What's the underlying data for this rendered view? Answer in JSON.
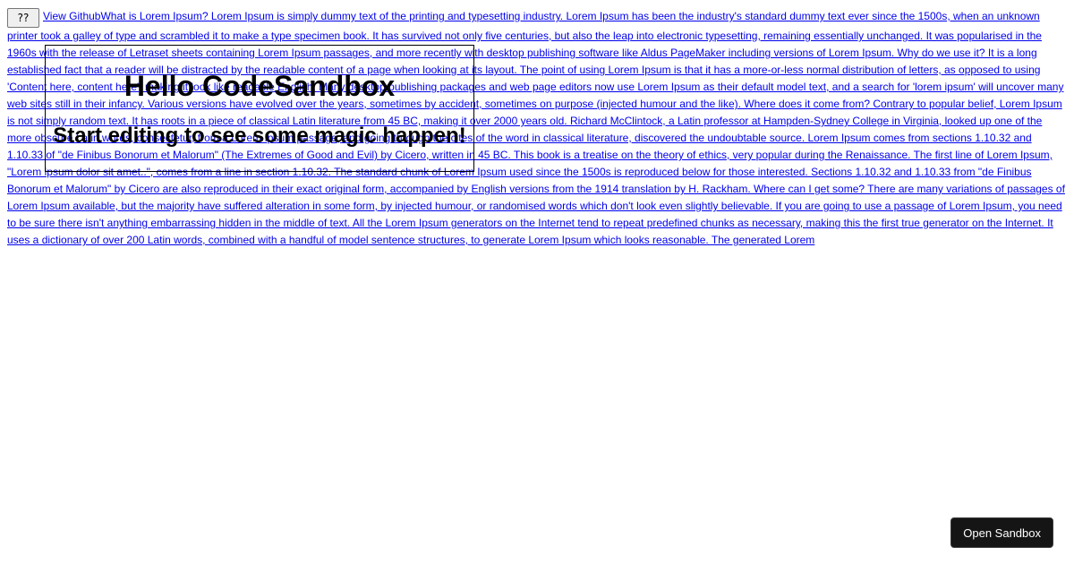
{
  "toolbar": {
    "menu_button_label": "??",
    "github_link": "View Github"
  },
  "body_text": "What is Lorem Ipsum? Lorem Ipsum is simply dummy text of the printing and typesetting industry. Lorem Ipsum has been the industry's standard dummy text ever since the 1500s, when an unknown printer took a galley of type and scrambled it to make a type specimen book. It has survived not only five centuries, but also the leap into electronic typesetting, remaining essentially unchanged. It was popularised in the 1960s with the release of Letraset sheets containing Lorem Ipsum passages, and more recently with desktop publishing software like Aldus PageMaker including versions of Lorem Ipsum. Why do we use it? It is a long established fact that a reader will be distracted by the readable content of a page when looking at its layout. The point of using Lorem Ipsum is that it has a more-or-less normal distribution of letters, as opposed to using 'Content here, content here', making it look like readable English. Many desktop publishing packages and web page editors now use Lorem Ipsum as their default model text, and a search for 'lorem ipsum' will uncover many web sites still in their infancy. Various versions have evolved over the years, sometimes by accident, sometimes on purpose (injected humour and the like). Where does it come from? Contrary to popular belief, Lorem Ipsum is not simply random text. It has roots in a piece of classical Latin literature from 45 BC, making it over 2000 years old. Richard McClintock, a Latin professor at Hampden-Sydney College in Virginia, looked up one of the more obscure Latin words, consectetur, from a Lorem Ipsum passage, and going through the cites of the word in classical literature, discovered the undoubtable source. Lorem Ipsum comes from sections 1.10.32 and 1.10.33 of \"de Finibus Bonorum et Malorum\" (The Extremes of Good and Evil) by Cicero, written in 45 BC. This book is a treatise on the theory of ethics, very popular during the Renaissance. The first line of Lorem Ipsum, \"Lorem ipsum dolor sit amet..\", comes from a line in section 1.10.32. The standard chunk of Lorem Ipsum used since the 1500s is reproduced below for those interested. Sections 1.10.32 and 1.10.33 from \"de Finibus Bonorum et Malorum\" by Cicero are also reproduced in their exact original form, accompanied by English versions from the 1914 translation by H. Rackham. Where can I get some? There are many variations of passages of Lorem Ipsum available, but the majority have suffered alteration in some form, by injected humour, or randomised words which don't look even slightly believable. If you are going to use a passage of Lorem Ipsum, you need to be sure there isn't anything embarrassing hidden in the middle of text. All the Lorem Ipsum generators on the Internet tend to repeat predefined chunks as necessary, making this the first true generator on the Internet. It uses a dictionary of over 200 Latin words, combined with a handful of model sentence structures, to generate Lorem Ipsum which looks reasonable. The generated Lorem",
  "hero": {
    "title": "Hello CodeSandbox",
    "subtitle": "Start editing to see some magic happen!"
  },
  "open_sandbox_label": "Open Sandbox"
}
